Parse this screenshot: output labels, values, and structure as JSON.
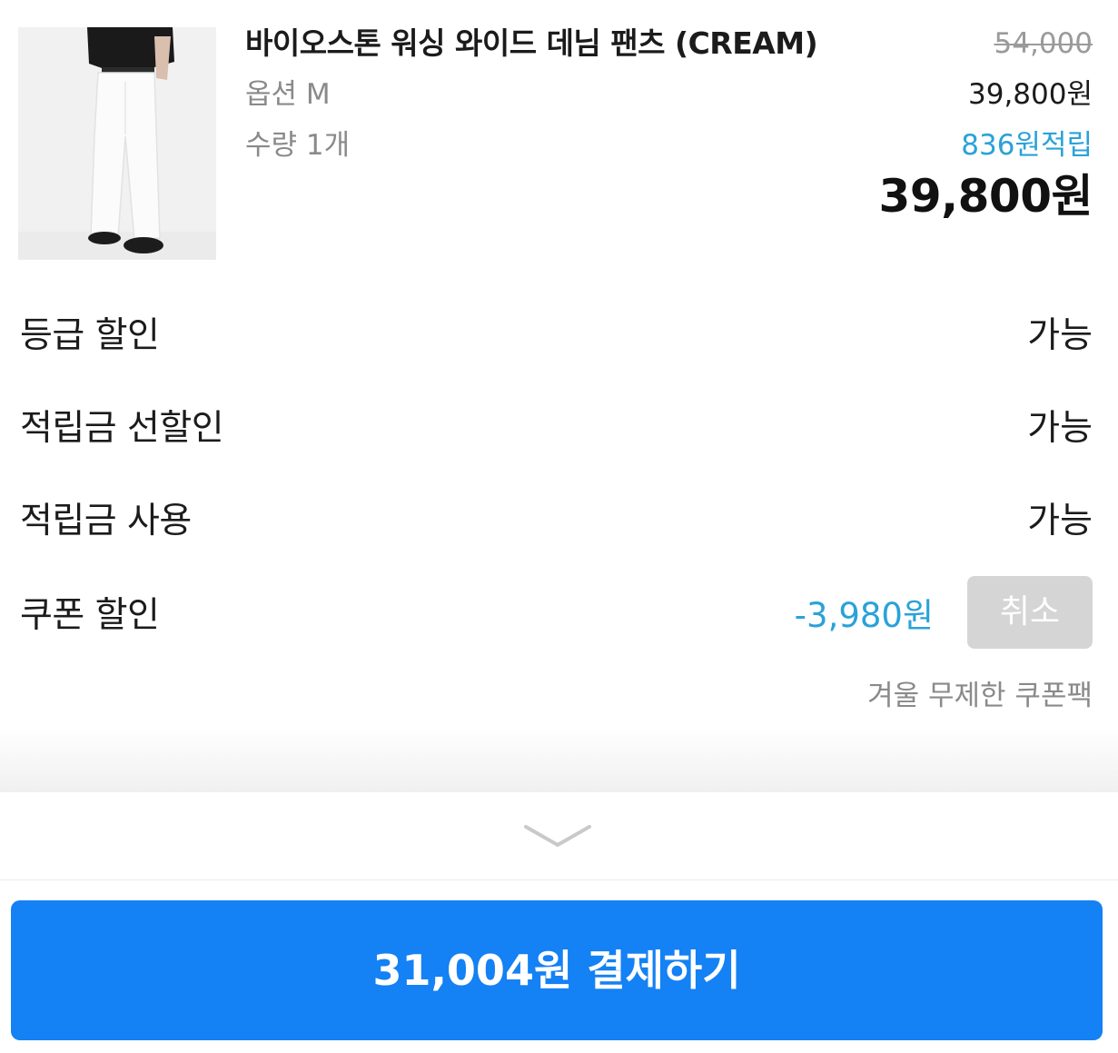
{
  "product": {
    "name": "바이오스톤 워싱 와이드 데님 팬츠 (CREAM)",
    "option_text": "옵션 M",
    "quantity_text": "수량 1개",
    "original_price": "54,000",
    "sale_price": "39,800원",
    "points": "836원적립",
    "total_price": "39,800원",
    "image_icon": "product-photo-white-wide-pants"
  },
  "discounts": [
    {
      "label": "등급 할인",
      "value": "가능"
    },
    {
      "label": "적립금 선할인",
      "value": "가능"
    },
    {
      "label": "적립금 사용",
      "value": "가능"
    }
  ],
  "coupon": {
    "label": "쿠폰 할인",
    "amount": "-3,980원",
    "cancel_label": "취소",
    "pack_name": "겨울 무제한 쿠폰팩"
  },
  "collapse": {
    "icon": "chevron-down-icon"
  },
  "payment": {
    "button_label": "31,004원 결제하기"
  },
  "colors": {
    "accent_blue": "#1481f4",
    "points_blue": "#2aa2d8",
    "muted_gray": "#8a8a8a",
    "disabled_button": "#d5d5d5"
  }
}
